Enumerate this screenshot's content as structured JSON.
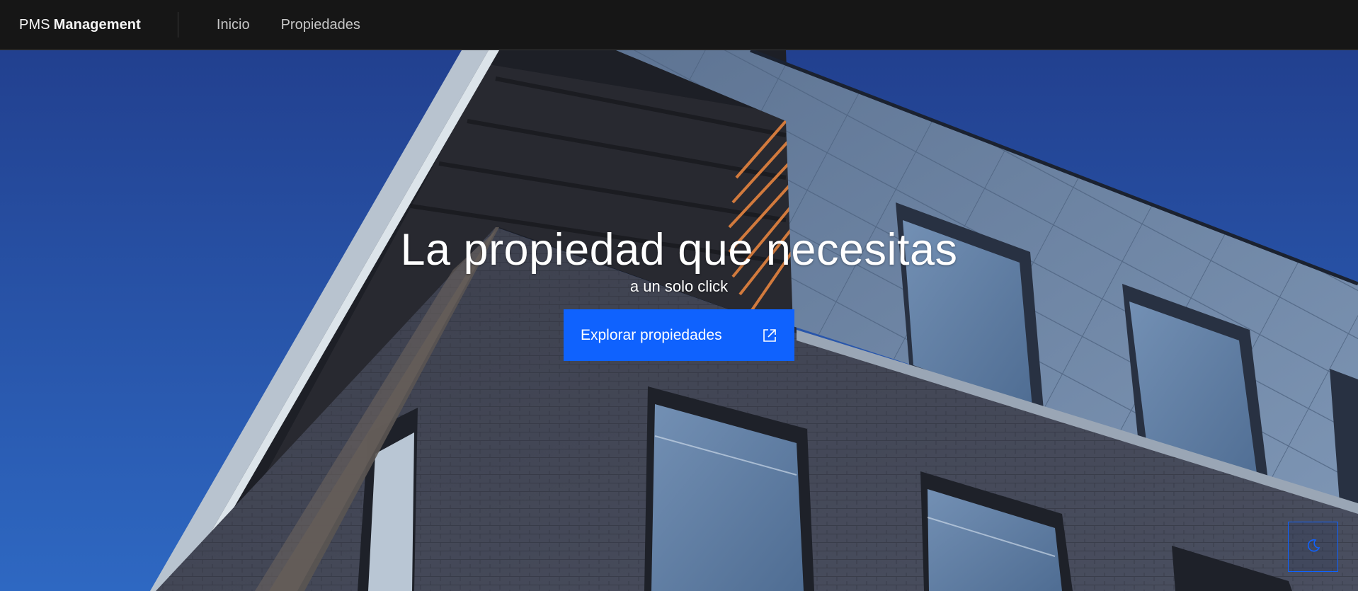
{
  "header": {
    "brand_prefix": "PMS",
    "brand_bold": "Management",
    "nav": [
      {
        "label": "Inicio"
      },
      {
        "label": "Propiedades"
      }
    ]
  },
  "hero": {
    "title": "La propiedad que necesitas",
    "subtitle": "a un solo click",
    "cta_label": "Explorar propiedades",
    "cta_icon": "external-link-icon",
    "background": "building-facade-photo"
  },
  "theme_toggle": {
    "icon": "moon-icon"
  },
  "colors": {
    "header_bg": "#161616",
    "accent": "#0f62fe",
    "sky": "#2a5db8"
  }
}
